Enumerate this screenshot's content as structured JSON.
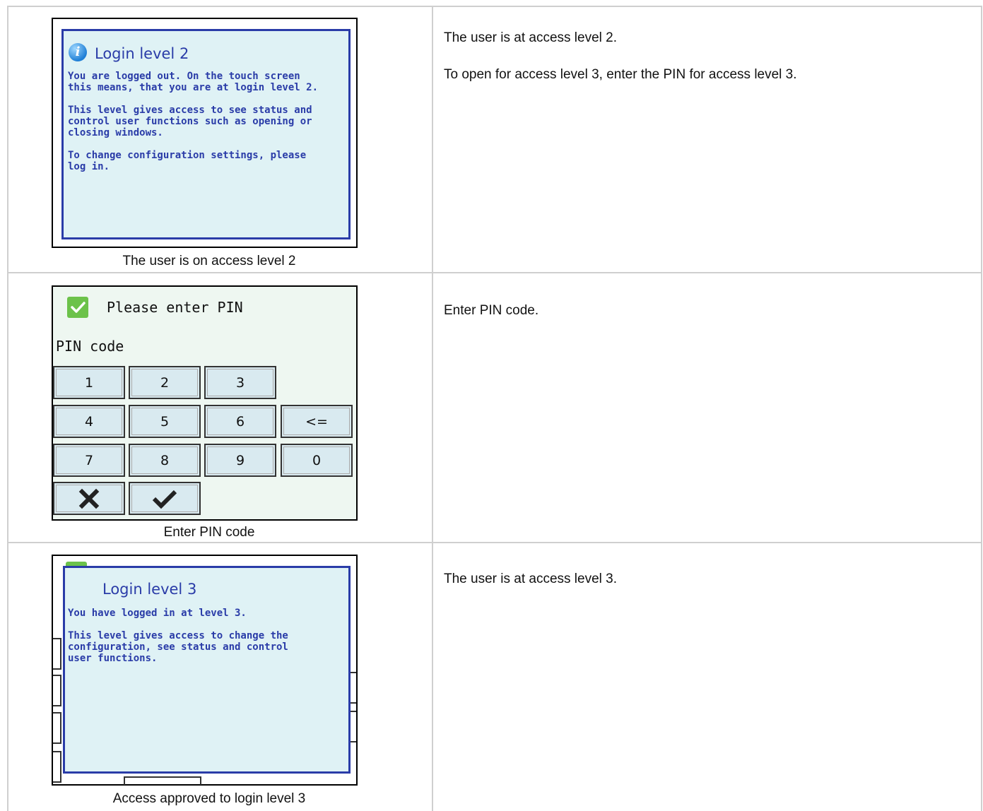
{
  "rows": [
    {
      "screen": {
        "title": "Login level 2",
        "text": "You are logged out. On the touch screen\nthis means, that you are at login level 2.\n\nThis level gives access to see status and\ncontrol user functions such as opening or\nclosing windows.\n\nTo change configuration settings, please\nlog in.",
        "icon": "info-icon"
      },
      "caption": "The user is on access level 2",
      "description": [
        "The user is at access level 2.",
        "To open for access level 3, enter the PIN for access level 3."
      ]
    },
    {
      "screen": {
        "title": "Please enter PIN",
        "field_label": "PIN code",
        "keys": [
          "1",
          "2",
          "3",
          "4",
          "5",
          "6",
          "<=",
          "7",
          "8",
          "9",
          "0"
        ],
        "icon": "check-icon",
        "cancel_icon": "close-icon",
        "confirm_icon": "checkmark-icon"
      },
      "caption": "Enter PIN code",
      "description": [
        "Enter PIN code."
      ]
    },
    {
      "screen": {
        "title": "Login level 3",
        "text": "You have logged in at level 3.\n\nThis level gives access to change the\nconfiguration, see status and control\nuser functions."
      },
      "caption": "Access approved to login level 3",
      "description": [
        "The user is at access level 3."
      ]
    }
  ],
  "colors": {
    "dialog_bg": "#dff2f5",
    "dialog_border": "#2a3ca8",
    "key_bg": "#d9eaf0",
    "check_green": "#6cc24a",
    "grid_line": "#cfcfcf"
  }
}
